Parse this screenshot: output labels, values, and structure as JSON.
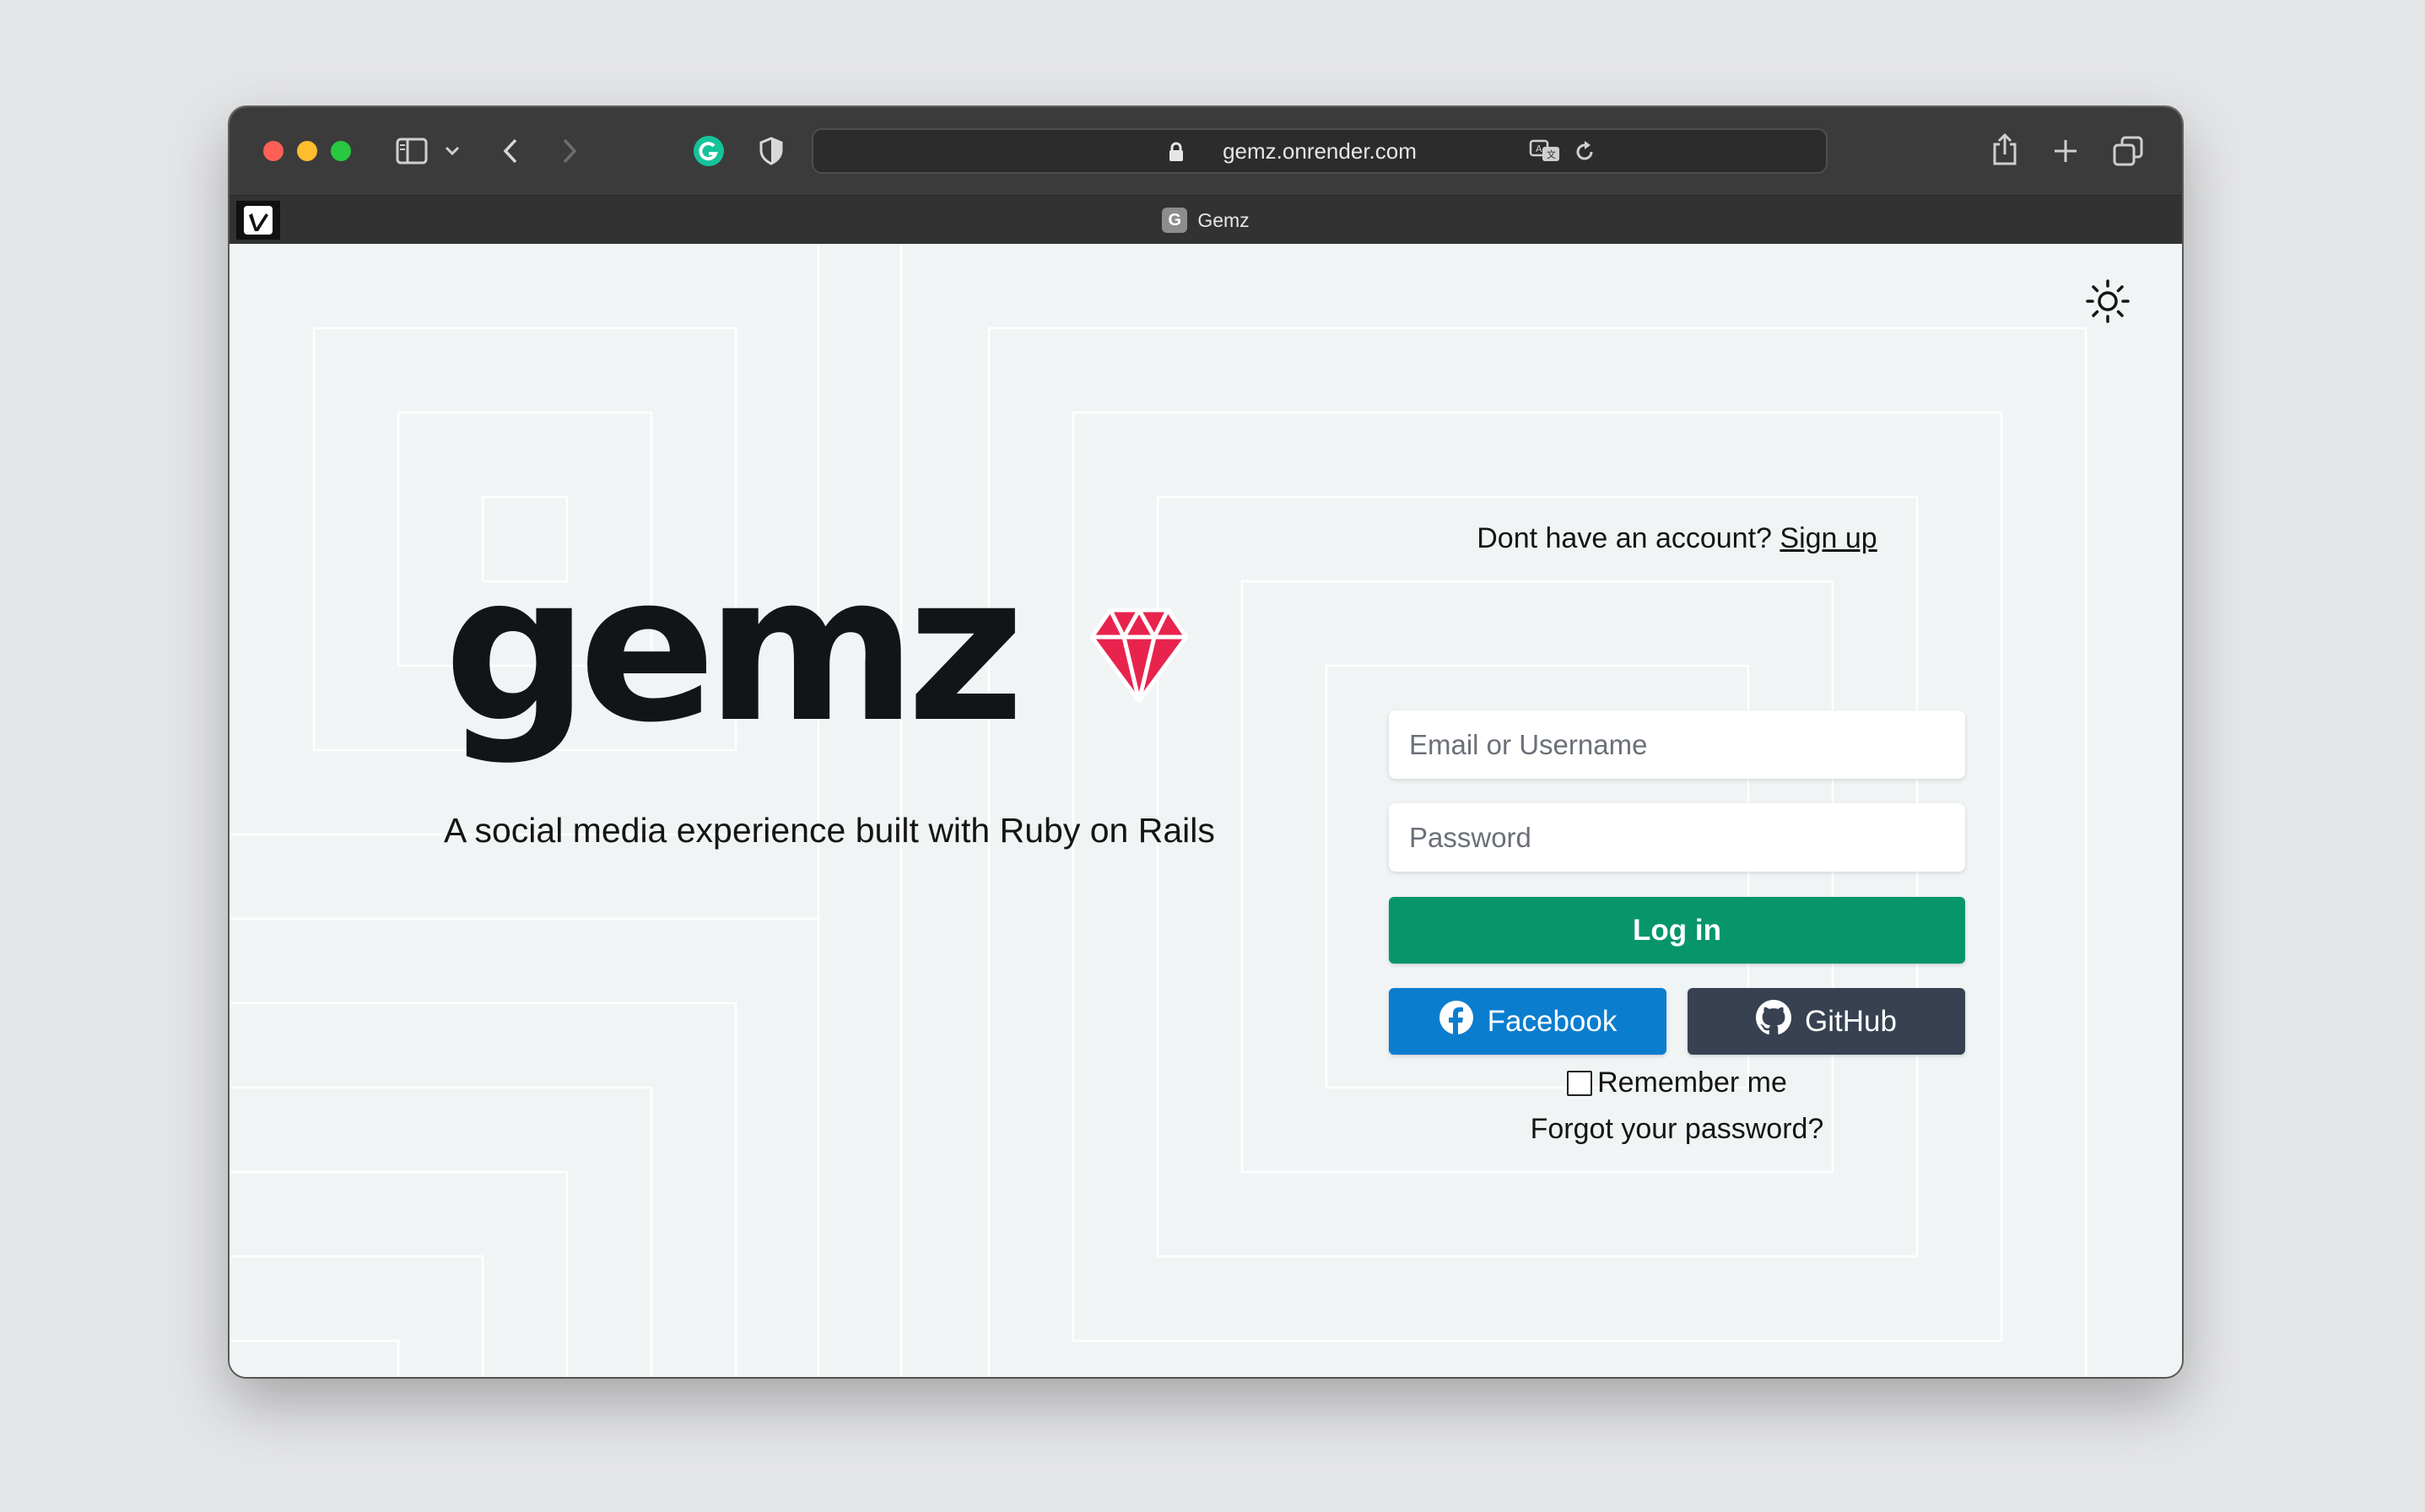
{
  "browser": {
    "url": "gemz.onrender.com",
    "tab_title": "Gemz",
    "tab_favicon_letter": "G"
  },
  "brand": {
    "logo_text": "gemz",
    "tagline": "A social media experience built with Ruby on Rails",
    "accent": "#e8244e"
  },
  "login": {
    "signup_prompt": "Dont have an account?",
    "signup_link": "Sign up",
    "email_placeholder": "Email or Username",
    "password_placeholder": "Password",
    "login_label": "Log in",
    "login_color": "#06966a",
    "facebook_label": "Facebook",
    "facebook_color": "#0b7dcf",
    "github_label": "GitHub",
    "github_color": "#374151",
    "remember_label": "Remember me",
    "forgot_label": "Forgot your password?"
  }
}
